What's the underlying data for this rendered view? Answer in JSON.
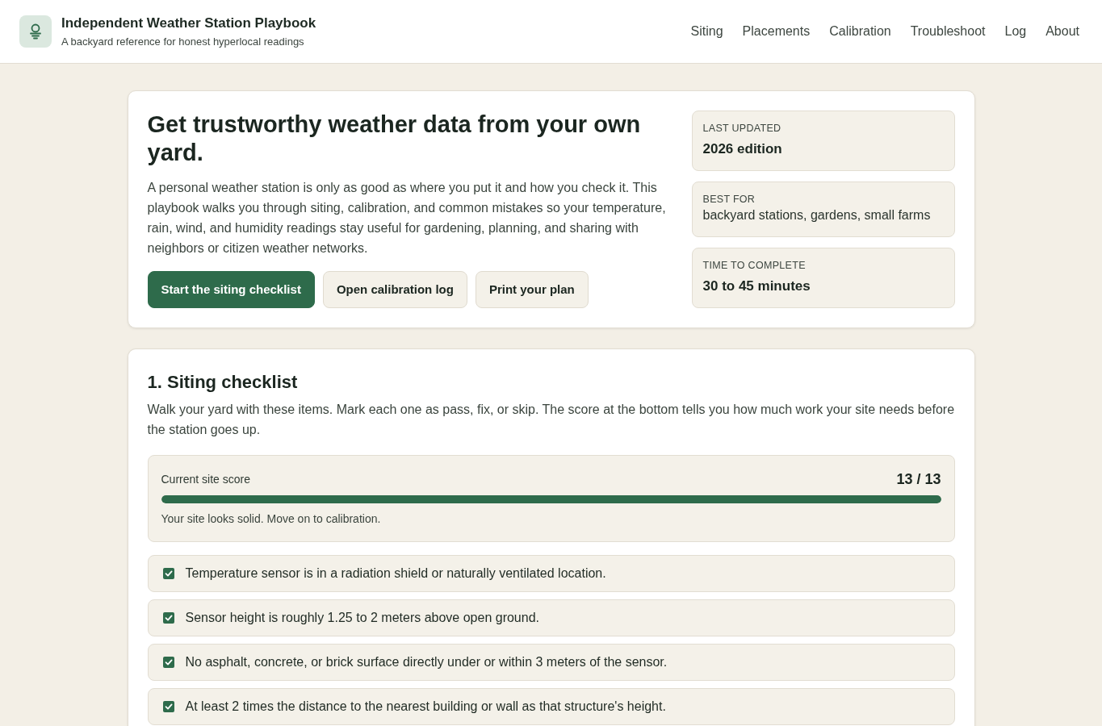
{
  "header": {
    "title": "Independent Weather Station Playbook",
    "subtitle": "A backyard reference for honest hyperlocal readings",
    "nav": [
      "Siting",
      "Placements",
      "Calibration",
      "Troubleshoot",
      "Log",
      "About"
    ]
  },
  "hero": {
    "heading": "Get trustworthy weather data from your own yard.",
    "intro": "A personal weather station is only as good as where you put it and how you check it. This playbook walks you through siting, calibration, and common mistakes so your temperature, rain, wind, and humidity readings stay useful for gardening, planning, and sharing with neighbors or citizen weather networks.",
    "buttons": [
      {
        "label": "Start the siting checklist",
        "kind": "primary"
      },
      {
        "label": "Open calibration log",
        "kind": "secondary"
      },
      {
        "label": "Print your plan",
        "kind": "secondary"
      }
    ],
    "facts": [
      {
        "label": "LAST UPDATED",
        "value": "2026 edition",
        "kind": "strong"
      },
      {
        "label": "BEST FOR",
        "value": "backyard stations, gardens, small farms",
        "kind": "plain"
      },
      {
        "label": "TIME TO COMPLETE",
        "value": "30 to 45 minutes",
        "kind": "strong"
      }
    ]
  },
  "siting": {
    "heading": "1. Siting checklist",
    "intro": "Walk your yard with these items. Mark each one as pass, fix, or skip. The score at the bottom tells you how much work your site needs before the station goes up.",
    "score": {
      "label": "Current site score",
      "value": "13 / 13",
      "level": 1,
      "message": "Your site looks solid. Move on to calibration."
    },
    "items": [
      {
        "text": "Temperature sensor is in a radiation shield or naturally ventilated location.",
        "checked": true
      },
      {
        "text": "Sensor height is roughly 1.25 to 2 meters above open ground.",
        "checked": true
      },
      {
        "text": "No asphalt, concrete, or brick surface directly under or within 3 meters of the sensor.",
        "checked": true
      },
      {
        "text": "At least 2 times the distance to the nearest building or wall as that structure's height.",
        "checked": true
      }
    ]
  }
}
